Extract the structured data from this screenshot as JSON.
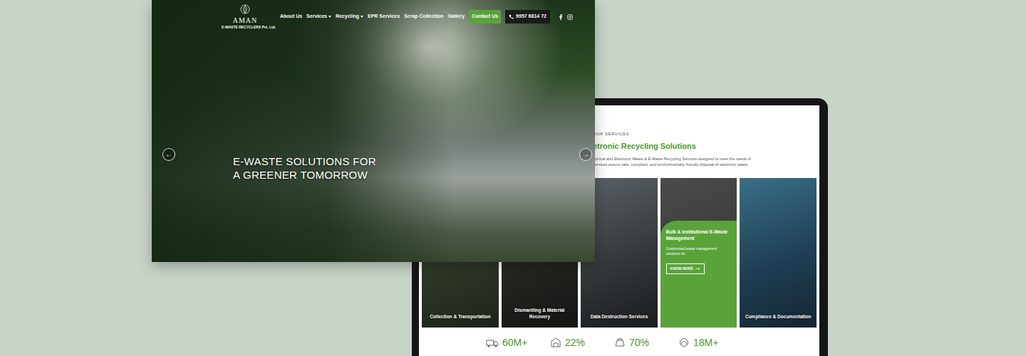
{
  "desktop": {
    "logo": {
      "name": "AMAN",
      "tagline": "E-WASTE RECYCLERS Pvt. Ltd."
    },
    "nav": [
      {
        "label": "About Us",
        "dropdown": false
      },
      {
        "label": "Services",
        "dropdown": true
      },
      {
        "label": "Recycling",
        "dropdown": true
      },
      {
        "label": "EPR Services",
        "dropdown": false
      },
      {
        "label": "Scrap Collection",
        "dropdown": false
      },
      {
        "label": "Gallery",
        "dropdown": false
      }
    ],
    "contact_button": "Contact Us",
    "phone": "9957 6814 72",
    "hero": {
      "title_lines": [
        "E-WASTE SOLUTIONS FOR",
        "A GREENER TOMORROW"
      ],
      "prev": "←",
      "next": "→"
    }
  },
  "tablet": {
    "eyebrow": "OUR SERVICES",
    "heading": "etronic Recycling Solutions",
    "intro": [
      "ectrical and Electronic Waste & E-Waste Recycling Services designed to meet the needs of",
      "services ensure safe, compliant, and environmentally friendly disposal of electronic waste."
    ],
    "services": [
      {
        "title": "Collection & Transportation",
        "kind": "photo"
      },
      {
        "title": "Dismantling & Material Recovery",
        "kind": "photo"
      },
      {
        "title": "Data Destruction Services",
        "kind": "photo"
      },
      {
        "title": "Bulk & Institutional E-Waste Management",
        "kind": "featured",
        "text": "Customised waste management solutions for",
        "button": "KNOW MORE"
      },
      {
        "title": "Compliance & Documentation",
        "kind": "photo"
      }
    ],
    "stats": [
      {
        "value": "60M+"
      },
      {
        "value": "22%"
      },
      {
        "value": "70%"
      },
      {
        "value": "18M+"
      }
    ]
  }
}
